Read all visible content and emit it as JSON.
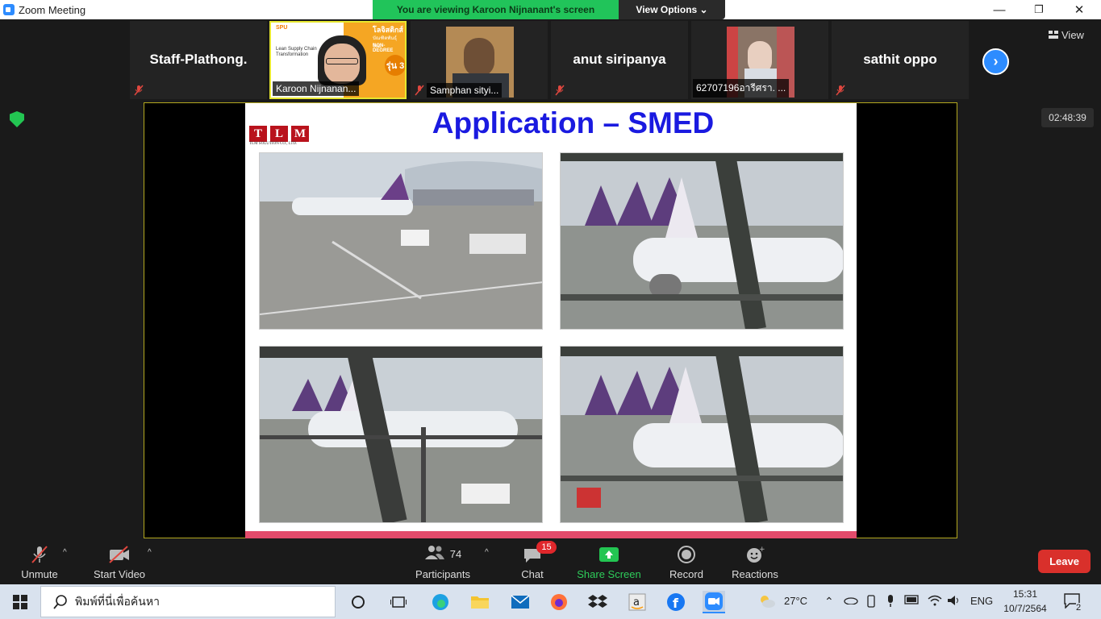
{
  "window": {
    "title": "Zoom Meeting"
  },
  "banner": {
    "viewing": "You are viewing Karoon Nijnanant's screen",
    "view_options": "View Options ⌄"
  },
  "controls": {
    "minimize": "—",
    "restore": "❐",
    "close": "✕"
  },
  "strip": {
    "tiles": [
      {
        "name": "Staff-Plathong.",
        "muted": true
      },
      {
        "name": "Karoon Nijnanan...",
        "video": true,
        "active": true
      },
      {
        "name": "Samphan sityi...",
        "video": true
      },
      {
        "name": "anut siripanya",
        "muted": true
      },
      {
        "name": "62707196อารีศรา. ...",
        "video": true
      },
      {
        "name": "sathit oppo",
        "muted": true
      }
    ],
    "view_label": "View",
    "karoon_banner": {
      "line1": "SPU",
      "line2": "โลจิสติกส์",
      "line3": "บัณฑิตพันธุ์ใหม่",
      "line4": "NON-DEGREE",
      "line5": "รุ่น 3",
      "line6": "Lean Supply Chain",
      "line7": "Transformation"
    }
  },
  "timer": "02:48:39",
  "slide": {
    "logo_letters": [
      "T",
      "L",
      "M"
    ],
    "logo_sub": "TLM SOLUTION CO., LTD.",
    "title": "Application – SMED"
  },
  "toolbar": {
    "unmute": "Unmute",
    "start_video": "Start Video",
    "participants": "Participants",
    "participants_count": "74",
    "chat": "Chat",
    "chat_badge": "15",
    "share_screen": "Share Screen",
    "record": "Record",
    "reactions": "Reactions",
    "leave": "Leave"
  },
  "taskbar": {
    "search_placeholder": "พิมพ์ที่นี่เพื่อค้นหา",
    "weather": "27°C",
    "lang": "ENG",
    "time": "15:31",
    "date": "10/7/2564",
    "notif": "2"
  }
}
